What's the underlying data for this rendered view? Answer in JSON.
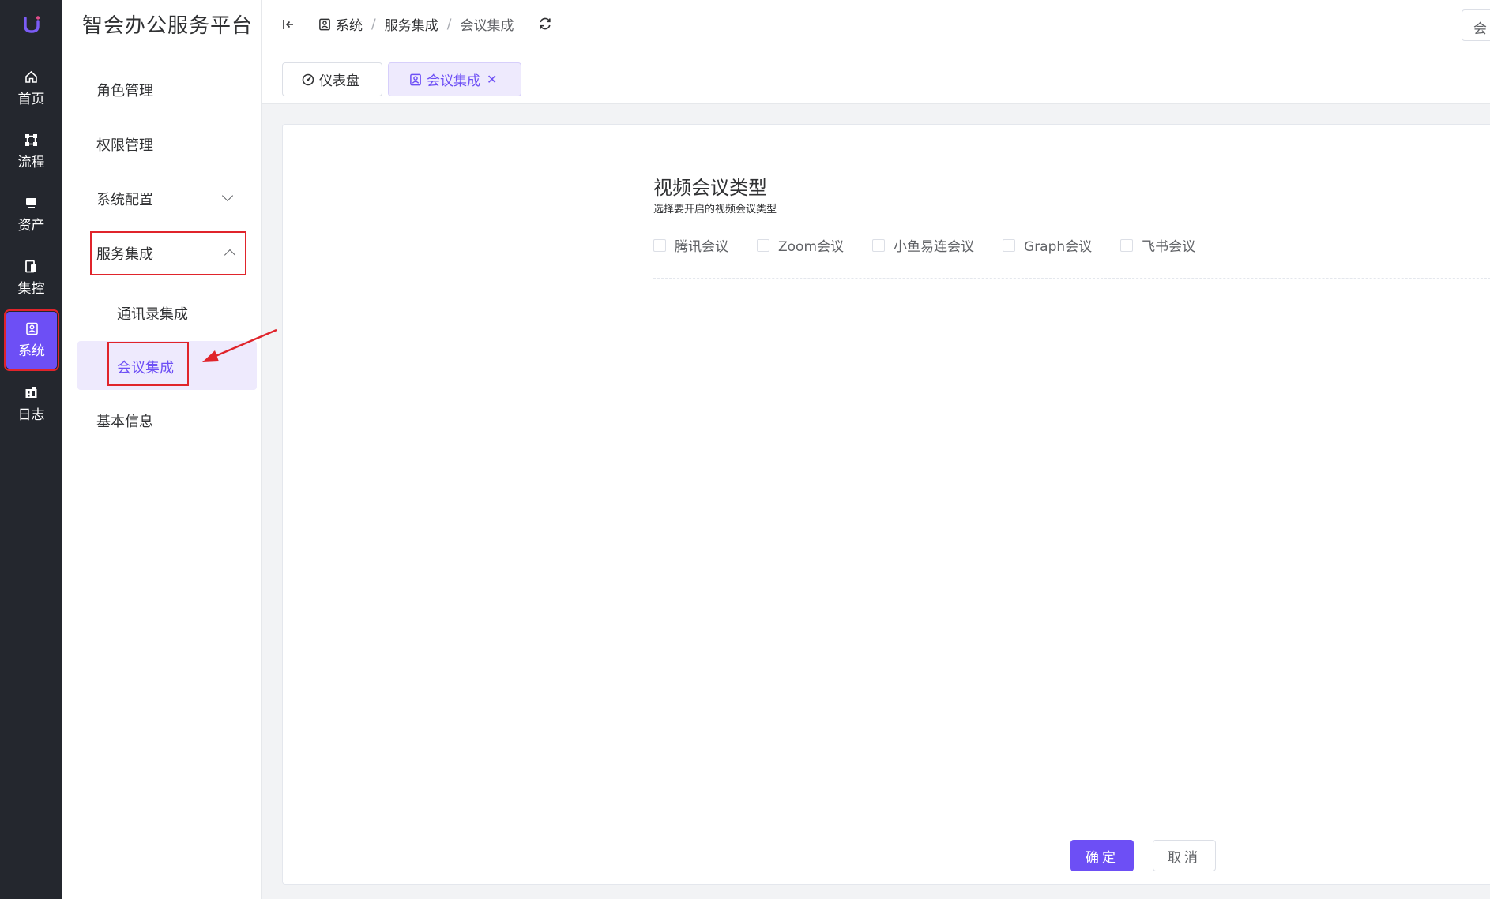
{
  "app": {
    "title": "智会办公服务平台"
  },
  "rail": {
    "items": [
      {
        "label": "首页",
        "icon": "home-icon"
      },
      {
        "label": "流程",
        "icon": "flow-icon"
      },
      {
        "label": "资产",
        "icon": "asset-icon"
      },
      {
        "label": "集控",
        "icon": "control-icon"
      },
      {
        "label": "系统",
        "icon": "system-icon",
        "active": true
      },
      {
        "label": "日志",
        "icon": "log-icon"
      }
    ]
  },
  "sidebar": {
    "items": [
      {
        "label": "角色管理"
      },
      {
        "label": "权限管理"
      },
      {
        "label": "系统配置"
      },
      {
        "label": "服务集成"
      },
      {
        "label": "通讯录集成"
      },
      {
        "label": "会议集成"
      },
      {
        "label": "基本信息"
      }
    ]
  },
  "breadcrumb": {
    "items": [
      "系统",
      "服务集成",
      "会议集成"
    ]
  },
  "header": {
    "right_button_label": "会"
  },
  "tabs": [
    {
      "label": "仪表盘"
    },
    {
      "label": "会议集成",
      "active": true
    }
  ],
  "main": {
    "section_title": "视频会议类型",
    "section_subtitle": "选择要开启的视频会议类型",
    "options": [
      {
        "label": "腾讯会议",
        "checked": false
      },
      {
        "label": "Zoom会议",
        "checked": false
      },
      {
        "label": "小鱼易连会议",
        "checked": false
      },
      {
        "label": "Graph会议",
        "checked": false
      },
      {
        "label": "飞书会议",
        "checked": false
      }
    ],
    "confirm_label": "确定",
    "cancel_label": "取消"
  },
  "colors": {
    "accent": "#6d4ff5",
    "rail_bg": "#24272e",
    "highlight_red": "#e0242b"
  }
}
